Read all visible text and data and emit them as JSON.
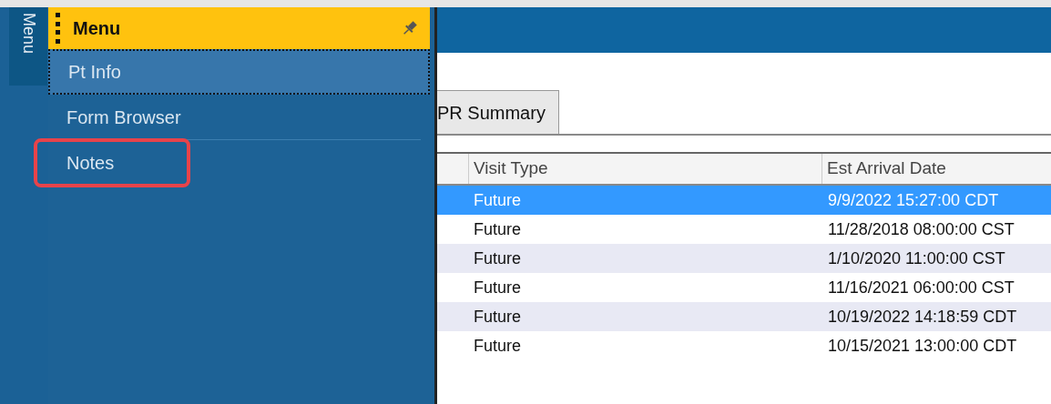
{
  "side_tab": {
    "label": "Menu",
    "selected": true
  },
  "menu": {
    "title": "Menu",
    "pinned": true,
    "items": [
      {
        "label": "Pt Info",
        "selected": true,
        "highlighted": false
      },
      {
        "label": "Form Browser",
        "selected": false,
        "highlighted": false
      },
      {
        "label": "Notes",
        "selected": false,
        "highlighted": true
      }
    ]
  },
  "tabs": [
    {
      "label": "PR Summary",
      "selected": true
    }
  ],
  "table": {
    "columns": [
      "Visit Type",
      "Est Arrival Date"
    ],
    "rows": [
      {
        "cells": [
          "Future",
          "9/9/2022 15:27:00 CDT"
        ],
        "selected": true
      },
      {
        "cells": [
          "Future",
          "11/28/2018 08:00:00 CST"
        ],
        "selected": false
      },
      {
        "cells": [
          "Future",
          "1/10/2020 11:00:00 CST"
        ],
        "selected": false
      },
      {
        "cells": [
          "Future",
          "11/16/2021 06:00:00 CST"
        ],
        "selected": false
      },
      {
        "cells": [
          "Future",
          "10/19/2022 14:18:59 CDT"
        ],
        "selected": false
      },
      {
        "cells": [
          "Future",
          "10/15/2021 13:00:00 CDT"
        ],
        "selected": false
      }
    ]
  }
}
